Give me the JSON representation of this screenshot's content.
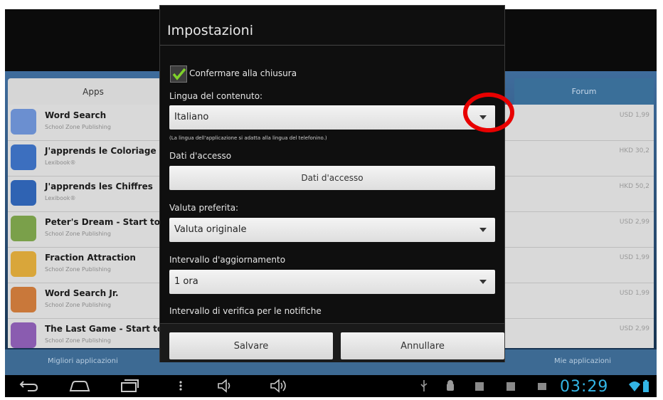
{
  "background_app": {
    "tab_apps": "Apps",
    "tab_forum": "Forum",
    "bottom_left": "Migliori applicazioni",
    "bottom_right": "Mie applicazioni",
    "apps": [
      {
        "title": "Word Search",
        "publisher": "School Zone Publishing",
        "price": "USD 1,99",
        "icon_color": "#6b8fd0"
      },
      {
        "title": "J'apprends le Coloriage",
        "publisher": "Lexibook®",
        "price": "HKD 30,2",
        "icon_color": "#3c6fbf"
      },
      {
        "title": "J'apprends les Chiffres",
        "publisher": "Lexibook®",
        "price": "HKD 50,2",
        "icon_color": "#2f63b3"
      },
      {
        "title": "Peter's Dream - Start to Re",
        "publisher": "School Zone Publishing",
        "price": "USD 2,99",
        "icon_color": "#7aa04a"
      },
      {
        "title": "Fraction Attraction",
        "publisher": "School Zone Publishing",
        "price": "USD 1,99",
        "icon_color": "#d9a63a"
      },
      {
        "title": "Word Search Jr.",
        "publisher": "School Zone Publishing",
        "price": "USD 1,99",
        "icon_color": "#c9783a"
      },
      {
        "title": "The Last Game - Start to Re",
        "publisher": "School Zone Publishing",
        "price": "USD 2,99",
        "icon_color": "#8a5cb0"
      }
    ]
  },
  "dialog": {
    "title": "Impostazioni",
    "confirm_close_label": "Confermare alla chiusura",
    "confirm_close_checked": true,
    "language_label": "Lingua del contenuto:",
    "language_value": "Italiano",
    "language_hint": "(La lingua dell'applicazione si adatta alla lingua del telefonino.)",
    "access_label": "Dati d'accesso",
    "access_button": "Dati d'accesso",
    "currency_label": "Valuta preferita:",
    "currency_value": "Valuta originale",
    "update_label": "Intervallo d'aggiornamento",
    "update_value": "1 ora",
    "notify_label": "Intervallo di verifica per le notifiche",
    "save_button": "Salvare",
    "cancel_button": "Annullare"
  },
  "statusbar": {
    "time": "03:29"
  },
  "colors": {
    "accent": "#33b5e5",
    "annotation": "#e80000"
  }
}
